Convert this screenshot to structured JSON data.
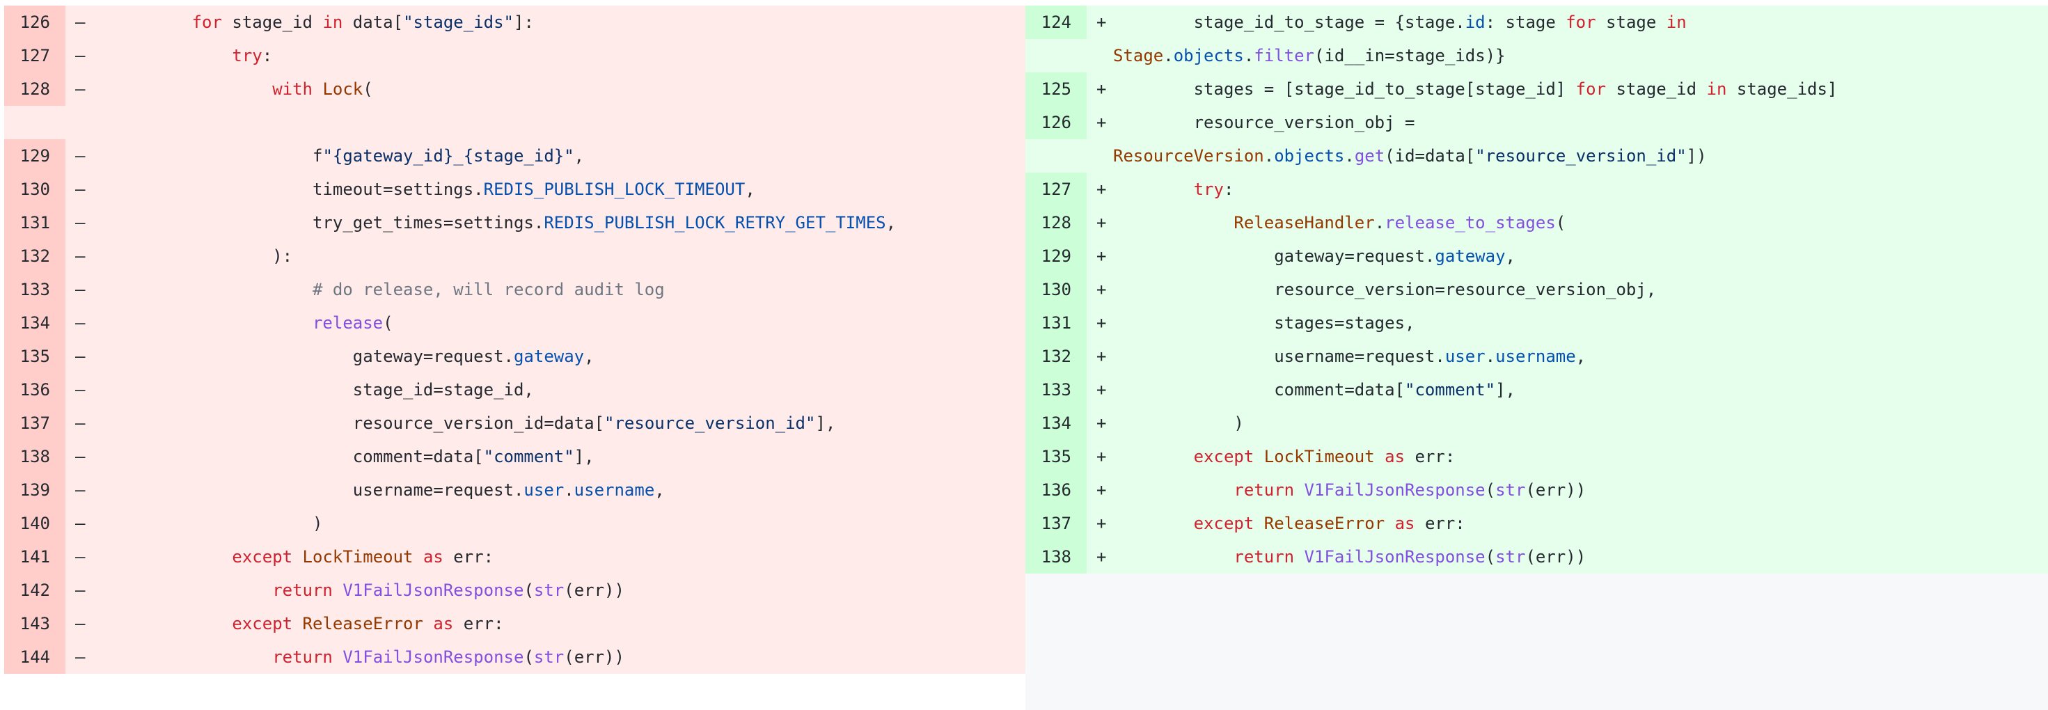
{
  "left": {
    "rows": [
      {
        "num": "126",
        "sign": "–",
        "html": "        <span class=\"kw\">for</span> stage_id <span class=\"kw\">in</span> data[<span class=\"str\">\"stage_ids\"</span>]:",
        "wrap": false
      },
      {
        "num": "127",
        "sign": "–",
        "html": "            <span class=\"kw\">try</span>:",
        "wrap": false
      },
      {
        "num": "128",
        "sign": "–",
        "html": "                <span class=\"kw\">with</span> <span class=\"cls\">Lock</span>(",
        "wrap": true
      },
      {
        "num": "129",
        "sign": "–",
        "html": "                    f<span class=\"str\">\"{gateway_id}_{stage_id}\"</span>,",
        "wrap": false
      },
      {
        "num": "130",
        "sign": "–",
        "html": "                    timeout=settings.<span class=\"attr\">REDIS_PUBLISH_LOCK_TIMEOUT</span>,",
        "wrap": false
      },
      {
        "num": "131",
        "sign": "–",
        "html": "                    try_get_times=settings.<span class=\"attr\">REDIS_PUBLISH_LOCK_RETRY_GET_TIMES</span>,",
        "wrap": false
      },
      {
        "num": "132",
        "sign": "–",
        "html": "                ):",
        "wrap": false
      },
      {
        "num": "133",
        "sign": "–",
        "html": "                    <span class=\"cm\"># do release, will record audit log</span>",
        "wrap": false
      },
      {
        "num": "134",
        "sign": "–",
        "html": "                    <span class=\"fn\">release</span>(",
        "wrap": false
      },
      {
        "num": "135",
        "sign": "–",
        "html": "                        gateway=request.<span class=\"attr\">gateway</span>,",
        "wrap": false
      },
      {
        "num": "136",
        "sign": "–",
        "html": "                        stage_id=stage_id,",
        "wrap": false
      },
      {
        "num": "137",
        "sign": "–",
        "html": "                        resource_version_id=data[<span class=\"str\">\"resource_version_id\"</span>],",
        "wrap": false
      },
      {
        "num": "138",
        "sign": "–",
        "html": "                        comment=data[<span class=\"str\">\"comment\"</span>],",
        "wrap": false
      },
      {
        "num": "139",
        "sign": "–",
        "html": "                        username=request.<span class=\"attr\">user</span>.<span class=\"attr\">username</span>,",
        "wrap": false
      },
      {
        "num": "140",
        "sign": "–",
        "html": "                    )",
        "wrap": false
      },
      {
        "num": "141",
        "sign": "–",
        "html": "            <span class=\"kw\">except</span> <span class=\"cls\">LockTimeout</span> <span class=\"kw\">as</span> err:",
        "wrap": false
      },
      {
        "num": "142",
        "sign": "–",
        "html": "                <span class=\"kw\">return</span> <span class=\"fn\">V1FailJsonResponse</span>(<span class=\"fn\">str</span>(err))",
        "wrap": false
      },
      {
        "num": "143",
        "sign": "–",
        "html": "            <span class=\"kw\">except</span> <span class=\"cls\">ReleaseError</span> <span class=\"kw\">as</span> err:",
        "wrap": false
      },
      {
        "num": "144",
        "sign": "–",
        "html": "                <span class=\"kw\">return</span> <span class=\"fn\">V1FailJsonResponse</span>(<span class=\"fn\">str</span>(err))",
        "wrap": false
      }
    ]
  },
  "right": {
    "rows": [
      {
        "num": "124",
        "sign": "+",
        "html": "        stage_id_to_stage = {stage.<span class=\"attr\">id</span>: stage <span class=\"kw\">for</span> stage <span class=\"kw\">in</span>\n<span class=\"cls\">Stage</span>.<span class=\"attr\">objects</span>.<span class=\"fn\">filter</span>(id__in=stage_ids)}",
        "wrap": true
      },
      {
        "num": "125",
        "sign": "+",
        "html": "        stages = [stage_id_to_stage[stage_id] <span class=\"kw\">for</span> stage_id <span class=\"kw\">in</span> stage_ids]",
        "wrap": false
      },
      {
        "num": "126",
        "sign": "+",
        "html": "        resource_version_obj =\n<span class=\"cls\">ResourceVersion</span>.<span class=\"attr\">objects</span>.<span class=\"fn\">get</span>(id=data[<span class=\"str\">\"resource_version_id\"</span>])",
        "wrap": true
      },
      {
        "num": "127",
        "sign": "+",
        "html": "        <span class=\"kw\">try</span>:",
        "wrap": false
      },
      {
        "num": "128",
        "sign": "+",
        "html": "            <span class=\"cls\">ReleaseHandler</span>.<span class=\"fn\">release_to_stages</span>(",
        "wrap": false
      },
      {
        "num": "129",
        "sign": "+",
        "html": "                gateway=request.<span class=\"attr\">gateway</span>,",
        "wrap": false
      },
      {
        "num": "130",
        "sign": "+",
        "html": "                resource_version=resource_version_obj,",
        "wrap": false
      },
      {
        "num": "131",
        "sign": "+",
        "html": "                stages=stages,",
        "wrap": false
      },
      {
        "num": "132",
        "sign": "+",
        "html": "                username=request.<span class=\"attr\">user</span>.<span class=\"attr\">username</span>,",
        "wrap": false
      },
      {
        "num": "133",
        "sign": "+",
        "html": "                comment=data[<span class=\"str\">\"comment\"</span>],",
        "wrap": false
      },
      {
        "num": "134",
        "sign": "+",
        "html": "            )",
        "wrap": false
      },
      {
        "num": "135",
        "sign": "+",
        "html": "        <span class=\"kw\">except</span> <span class=\"cls\">LockTimeout</span> <span class=\"kw\">as</span> err:",
        "wrap": false
      },
      {
        "num": "136",
        "sign": "+",
        "html": "            <span class=\"kw\">return</span> <span class=\"fn\">V1FailJsonResponse</span>(<span class=\"fn\">str</span>(err))",
        "wrap": false
      },
      {
        "num": "137",
        "sign": "+",
        "html": "        <span class=\"kw\">except</span> <span class=\"cls\">ReleaseError</span> <span class=\"kw\">as</span> err:",
        "wrap": false
      },
      {
        "num": "138",
        "sign": "+",
        "html": "            <span class=\"kw\">return</span> <span class=\"fn\">V1FailJsonResponse</span>(<span class=\"fn\">str</span>(err))",
        "wrap": false
      }
    ]
  }
}
